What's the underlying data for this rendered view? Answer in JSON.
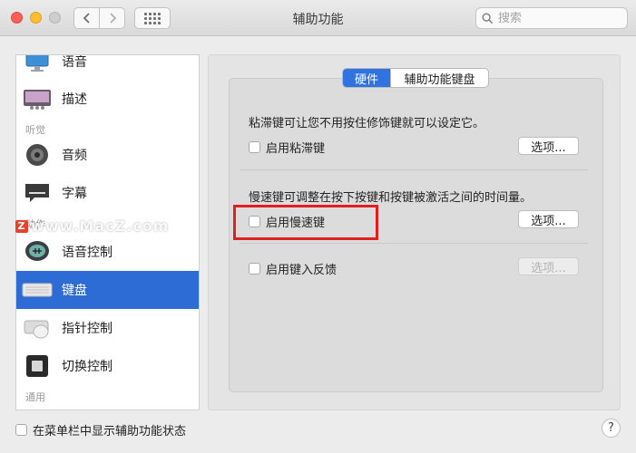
{
  "window": {
    "title": "辅助功能"
  },
  "toolbar": {
    "back_icon": "chevron-left-icon",
    "forward_icon": "chevron-right-icon",
    "grid_icon": "grid-icon"
  },
  "search": {
    "placeholder": "搜索"
  },
  "sidebar": {
    "items": [
      {
        "label": "语音",
        "icon": "speech-monitor-icon"
      },
      {
        "label": "描述",
        "icon": "description-icon"
      },
      {
        "label": "音频",
        "icon": "speaker-icon"
      },
      {
        "label": "字幕",
        "icon": "captions-icon"
      },
      {
        "label": "语音控制",
        "icon": "voice-control-icon"
      },
      {
        "label": "键盘",
        "icon": "keyboard-icon",
        "selected": true
      },
      {
        "label": "指针控制",
        "icon": "pointer-control-icon"
      },
      {
        "label": "切换控制",
        "icon": "switch-control-icon"
      }
    ],
    "categories": {
      "hearing": "听觉",
      "motor": "动作",
      "general": "通用"
    }
  },
  "tabs": [
    {
      "label": "硬件",
      "active": true
    },
    {
      "label": "辅助功能键盘",
      "active": false
    }
  ],
  "sticky_keys": {
    "description": "粘滞键可让您不用按住修饰键就可以设定它。",
    "checkbox_label": "启用粘滞键",
    "checked": false,
    "options_label": "选项..."
  },
  "slow_keys": {
    "description": "慢速键可调整在按下按键和按键被激活之间的时间量。",
    "checkbox_label": "启用慢速键",
    "checked": false,
    "options_label": "选项..."
  },
  "key_feedback": {
    "checkbox_label": "启用键入反馈",
    "checked": false,
    "options_label": "选项..."
  },
  "footer": {
    "menu_status_label": "在菜单栏中显示辅助功能状态",
    "help_label": "?"
  },
  "watermark": {
    "logo": "Z",
    "text": "www.MacZ.com"
  },
  "colors": {
    "selection": "#2d6bd5",
    "tab_active": "#2f73e0",
    "highlight": "#e02020"
  }
}
